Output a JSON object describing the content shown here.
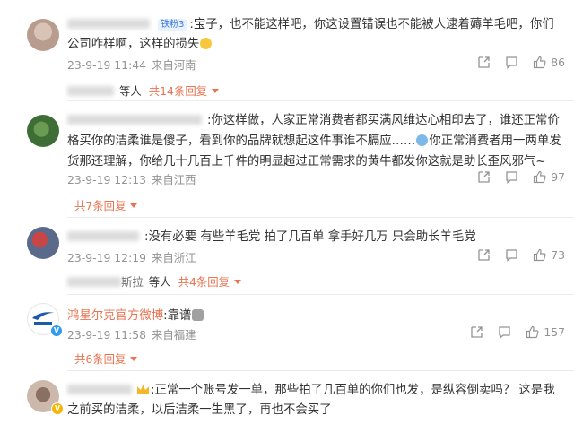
{
  "comments": [
    {
      "name": "",
      "badge": "铁粉3",
      "text": ":宝子，也不能这样吧，你这设置错误也不能被人逮着薅羊毛吧，你们公司咋样啊，这样的损失",
      "time": "23-9-19 11:44",
      "location": "来自河南",
      "likes": "86",
      "reply_people": "等人",
      "reply_more": "共14条回复"
    },
    {
      "name": "",
      "text": ":你这样做，人家正常消费者都买满风维达心相印去了，谁还正常价格买你的洁柔谁是傻子，看到你的品牌就想起这件事谁不膈应……",
      "text2": "你正常消费者用一两单发货那还理解，你给几十几百上千件的明显超过正常需求的黄牛都发你这就是助长歪风邪气~",
      "time": "23-9-19 12:13",
      "location": "来自江西",
      "likes": "97",
      "reply_more": "共7条回复"
    },
    {
      "name": "",
      "text": ":没有必要 有些羊毛党 拍了几百单 拿手好几万 只会助长羊毛党",
      "time": "23-9-19 12:19",
      "location": "来自浙江",
      "likes": "73",
      "reply_name_tail": "斯拉",
      "reply_people": "等人",
      "reply_more": "共4条回复"
    },
    {
      "name": "鸿星尔克官方微博",
      "text": ":靠谱",
      "time": "23-9-19 11:58",
      "location": "来自福建",
      "likes": "157",
      "reply_more": "共6条回复"
    },
    {
      "name": "",
      "text": ":正常一个账号发一单，那些拍了几百单的你们也发，是纵容倒卖吗？ 这是我之前买的洁柔，以后洁柔一生黑了，再也不会买了"
    }
  ],
  "icons": {
    "share": "share-icon",
    "comment": "comment-icon",
    "like": "thumbs-up-icon",
    "caret": "caret-down-icon"
  },
  "colors": {
    "accent": "#eb7350",
    "meta": "#939393",
    "badge_bg": "#e8f1fd",
    "badge_fg": "#3d7bd8"
  }
}
